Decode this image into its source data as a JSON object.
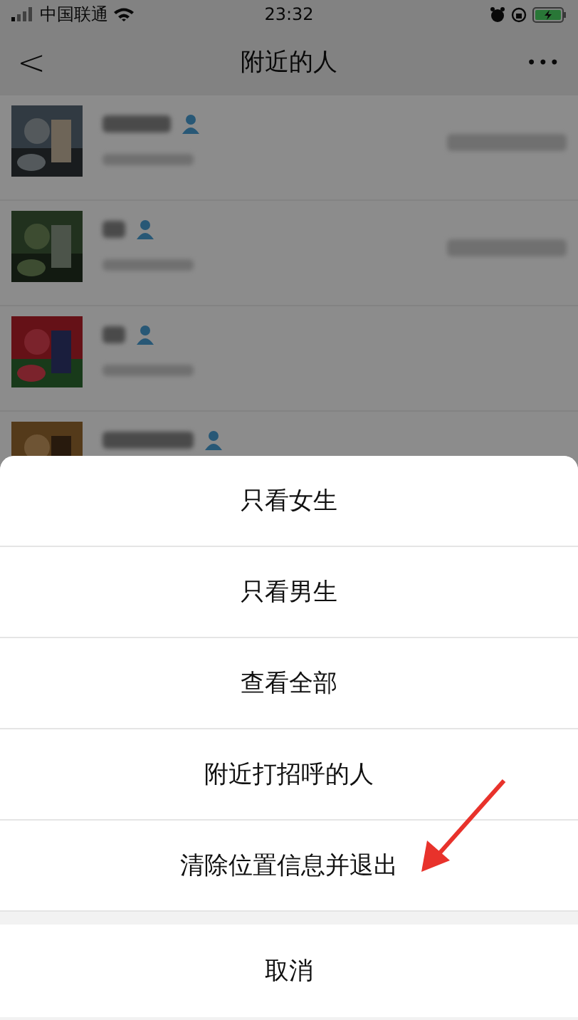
{
  "status_bar": {
    "carrier": "中国联通",
    "time": "23:32"
  },
  "nav_bar": {
    "back": "<",
    "title": "附近的人",
    "more": "•••"
  },
  "people": [
    {
      "kind": "picture",
      "note": true
    },
    {
      "kind": "picture",
      "note": true
    },
    {
      "kind": "picture",
      "note": false
    },
    {
      "kind": "picture",
      "note": false
    }
  ],
  "action_sheet": {
    "options": [
      {
        "label": "只看女生"
      },
      {
        "label": "只看男生"
      },
      {
        "label": "查看全部"
      },
      {
        "label": "附近打招呼的人"
      },
      {
        "label": "清除位置信息并退出"
      }
    ],
    "cancel": "取消"
  },
  "annotation": {
    "kind": "arrow",
    "color": "#e8322b"
  }
}
